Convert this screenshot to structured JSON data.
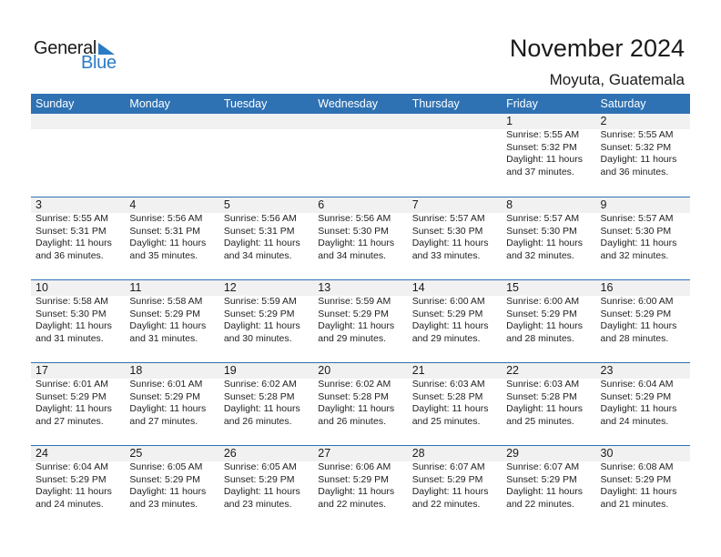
{
  "logo": {
    "word1": "General",
    "word2": "Blue",
    "icon": "triangle-flag-icon",
    "brand_color": "#2b7bc4"
  },
  "header": {
    "title": "November 2024",
    "location": "Moyuta, Guatemala"
  },
  "colors": {
    "header_bg": "#2e72b4",
    "day_band": "#f1f1f1"
  },
  "weekdays": [
    "Sunday",
    "Monday",
    "Tuesday",
    "Wednesday",
    "Thursday",
    "Friday",
    "Saturday"
  ],
  "weeks": [
    [
      null,
      null,
      null,
      null,
      null,
      {
        "day": "1",
        "sunrise": "Sunrise: 5:55 AM",
        "sunset": "Sunset: 5:32 PM",
        "daylight1": "Daylight: 11 hours",
        "daylight2": "and 37 minutes."
      },
      {
        "day": "2",
        "sunrise": "Sunrise: 5:55 AM",
        "sunset": "Sunset: 5:32 PM",
        "daylight1": "Daylight: 11 hours",
        "daylight2": "and 36 minutes."
      }
    ],
    [
      {
        "day": "3",
        "sunrise": "Sunrise: 5:55 AM",
        "sunset": "Sunset: 5:31 PM",
        "daylight1": "Daylight: 11 hours",
        "daylight2": "and 36 minutes."
      },
      {
        "day": "4",
        "sunrise": "Sunrise: 5:56 AM",
        "sunset": "Sunset: 5:31 PM",
        "daylight1": "Daylight: 11 hours",
        "daylight2": "and 35 minutes."
      },
      {
        "day": "5",
        "sunrise": "Sunrise: 5:56 AM",
        "sunset": "Sunset: 5:31 PM",
        "daylight1": "Daylight: 11 hours",
        "daylight2": "and 34 minutes."
      },
      {
        "day": "6",
        "sunrise": "Sunrise: 5:56 AM",
        "sunset": "Sunset: 5:30 PM",
        "daylight1": "Daylight: 11 hours",
        "daylight2": "and 34 minutes."
      },
      {
        "day": "7",
        "sunrise": "Sunrise: 5:57 AM",
        "sunset": "Sunset: 5:30 PM",
        "daylight1": "Daylight: 11 hours",
        "daylight2": "and 33 minutes."
      },
      {
        "day": "8",
        "sunrise": "Sunrise: 5:57 AM",
        "sunset": "Sunset: 5:30 PM",
        "daylight1": "Daylight: 11 hours",
        "daylight2": "and 32 minutes."
      },
      {
        "day": "9",
        "sunrise": "Sunrise: 5:57 AM",
        "sunset": "Sunset: 5:30 PM",
        "daylight1": "Daylight: 11 hours",
        "daylight2": "and 32 minutes."
      }
    ],
    [
      {
        "day": "10",
        "sunrise": "Sunrise: 5:58 AM",
        "sunset": "Sunset: 5:30 PM",
        "daylight1": "Daylight: 11 hours",
        "daylight2": "and 31 minutes."
      },
      {
        "day": "11",
        "sunrise": "Sunrise: 5:58 AM",
        "sunset": "Sunset: 5:29 PM",
        "daylight1": "Daylight: 11 hours",
        "daylight2": "and 31 minutes."
      },
      {
        "day": "12",
        "sunrise": "Sunrise: 5:59 AM",
        "sunset": "Sunset: 5:29 PM",
        "daylight1": "Daylight: 11 hours",
        "daylight2": "and 30 minutes."
      },
      {
        "day": "13",
        "sunrise": "Sunrise: 5:59 AM",
        "sunset": "Sunset: 5:29 PM",
        "daylight1": "Daylight: 11 hours",
        "daylight2": "and 29 minutes."
      },
      {
        "day": "14",
        "sunrise": "Sunrise: 6:00 AM",
        "sunset": "Sunset: 5:29 PM",
        "daylight1": "Daylight: 11 hours",
        "daylight2": "and 29 minutes."
      },
      {
        "day": "15",
        "sunrise": "Sunrise: 6:00 AM",
        "sunset": "Sunset: 5:29 PM",
        "daylight1": "Daylight: 11 hours",
        "daylight2": "and 28 minutes."
      },
      {
        "day": "16",
        "sunrise": "Sunrise: 6:00 AM",
        "sunset": "Sunset: 5:29 PM",
        "daylight1": "Daylight: 11 hours",
        "daylight2": "and 28 minutes."
      }
    ],
    [
      {
        "day": "17",
        "sunrise": "Sunrise: 6:01 AM",
        "sunset": "Sunset: 5:29 PM",
        "daylight1": "Daylight: 11 hours",
        "daylight2": "and 27 minutes."
      },
      {
        "day": "18",
        "sunrise": "Sunrise: 6:01 AM",
        "sunset": "Sunset: 5:29 PM",
        "daylight1": "Daylight: 11 hours",
        "daylight2": "and 27 minutes."
      },
      {
        "day": "19",
        "sunrise": "Sunrise: 6:02 AM",
        "sunset": "Sunset: 5:28 PM",
        "daylight1": "Daylight: 11 hours",
        "daylight2": "and 26 minutes."
      },
      {
        "day": "20",
        "sunrise": "Sunrise: 6:02 AM",
        "sunset": "Sunset: 5:28 PM",
        "daylight1": "Daylight: 11 hours",
        "daylight2": "and 26 minutes."
      },
      {
        "day": "21",
        "sunrise": "Sunrise: 6:03 AM",
        "sunset": "Sunset: 5:28 PM",
        "daylight1": "Daylight: 11 hours",
        "daylight2": "and 25 minutes."
      },
      {
        "day": "22",
        "sunrise": "Sunrise: 6:03 AM",
        "sunset": "Sunset: 5:28 PM",
        "daylight1": "Daylight: 11 hours",
        "daylight2": "and 25 minutes."
      },
      {
        "day": "23",
        "sunrise": "Sunrise: 6:04 AM",
        "sunset": "Sunset: 5:29 PM",
        "daylight1": "Daylight: 11 hours",
        "daylight2": "and 24 minutes."
      }
    ],
    [
      {
        "day": "24",
        "sunrise": "Sunrise: 6:04 AM",
        "sunset": "Sunset: 5:29 PM",
        "daylight1": "Daylight: 11 hours",
        "daylight2": "and 24 minutes."
      },
      {
        "day": "25",
        "sunrise": "Sunrise: 6:05 AM",
        "sunset": "Sunset: 5:29 PM",
        "daylight1": "Daylight: 11 hours",
        "daylight2": "and 23 minutes."
      },
      {
        "day": "26",
        "sunrise": "Sunrise: 6:05 AM",
        "sunset": "Sunset: 5:29 PM",
        "daylight1": "Daylight: 11 hours",
        "daylight2": "and 23 minutes."
      },
      {
        "day": "27",
        "sunrise": "Sunrise: 6:06 AM",
        "sunset": "Sunset: 5:29 PM",
        "daylight1": "Daylight: 11 hours",
        "daylight2": "and 22 minutes."
      },
      {
        "day": "28",
        "sunrise": "Sunrise: 6:07 AM",
        "sunset": "Sunset: 5:29 PM",
        "daylight1": "Daylight: 11 hours",
        "daylight2": "and 22 minutes."
      },
      {
        "day": "29",
        "sunrise": "Sunrise: 6:07 AM",
        "sunset": "Sunset: 5:29 PM",
        "daylight1": "Daylight: 11 hours",
        "daylight2": "and 22 minutes."
      },
      {
        "day": "30",
        "sunrise": "Sunrise: 6:08 AM",
        "sunset": "Sunset: 5:29 PM",
        "daylight1": "Daylight: 11 hours",
        "daylight2": "and 21 minutes."
      }
    ]
  ]
}
